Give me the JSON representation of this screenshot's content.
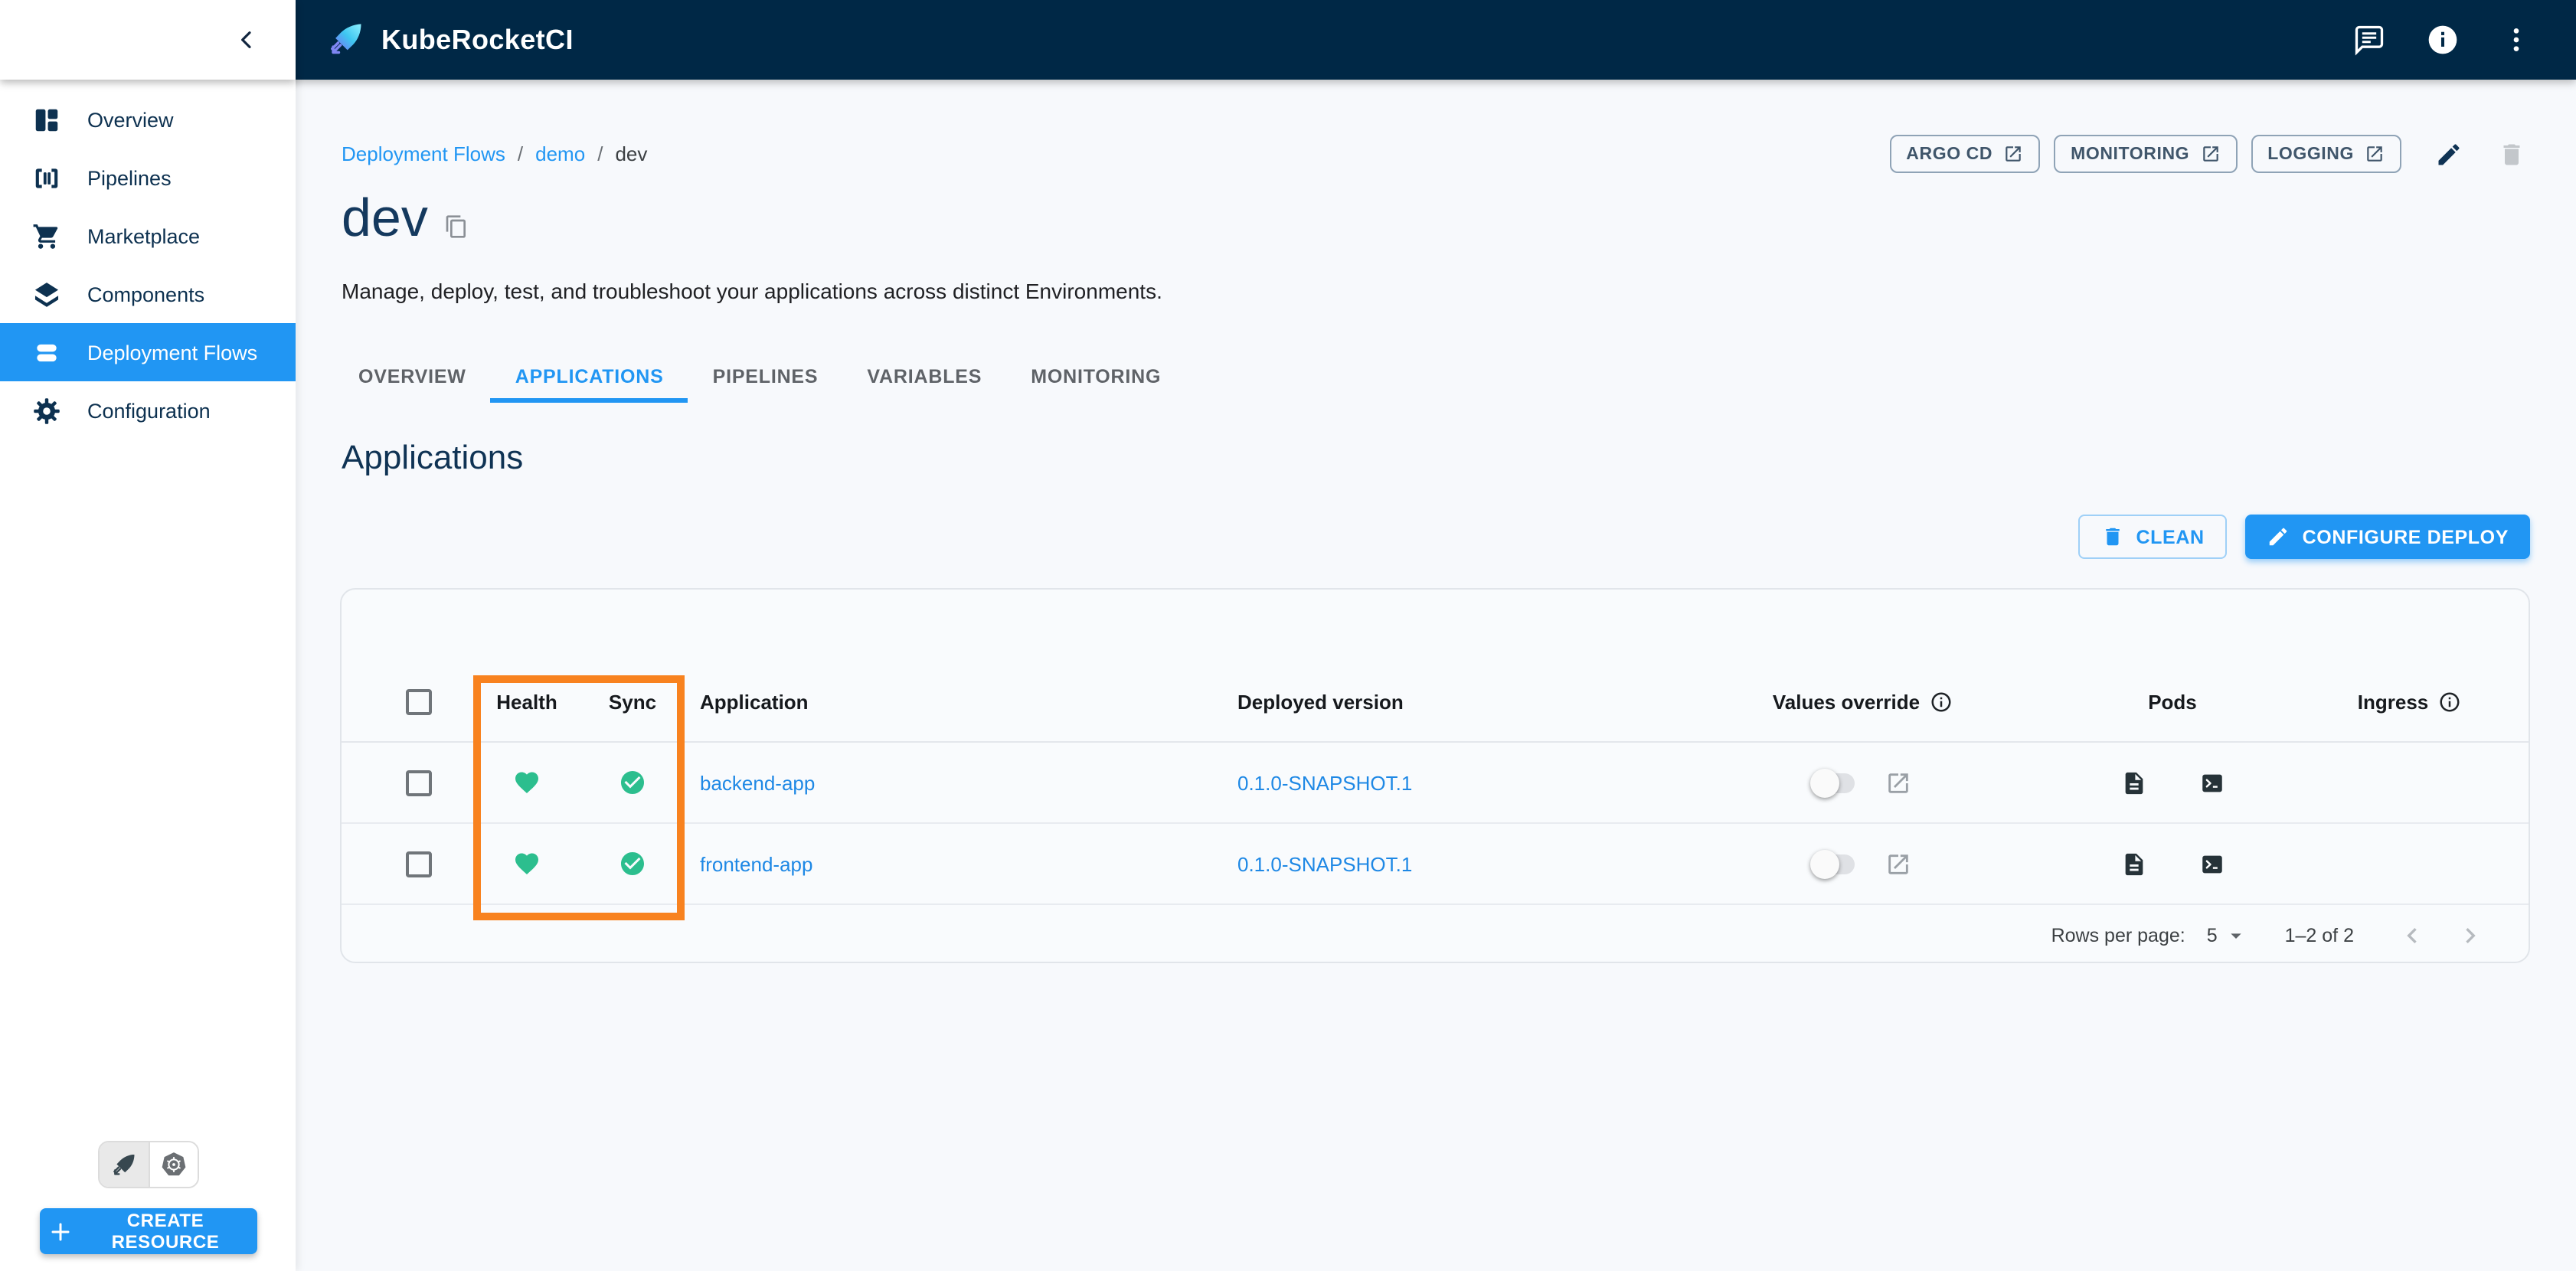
{
  "topbar": {
    "title": "KubeRocketCI",
    "icons": [
      "feedback-icon",
      "info-icon",
      "kebab-menu-icon"
    ]
  },
  "sidebar": {
    "collapse_icon": "chevron-left-icon",
    "items": [
      {
        "label": "Overview",
        "icon": "dashboard-icon",
        "selected": false
      },
      {
        "label": "Pipelines",
        "icon": "pipelines-icon",
        "selected": false
      },
      {
        "label": "Marketplace",
        "icon": "cart-icon",
        "selected": false
      },
      {
        "label": "Components",
        "icon": "layers-icon",
        "selected": false
      },
      {
        "label": "Deployment Flows",
        "icon": "stacked-bars-icon",
        "selected": true
      },
      {
        "label": "Configuration",
        "icon": "gear-icon",
        "selected": false
      }
    ],
    "view_toggle": [
      "kuberocketci-view-icon",
      "kubernetes-view-icon"
    ],
    "create_button": "CREATE RESOURCE"
  },
  "breadcrumb": {
    "separator": "/",
    "items": [
      {
        "label": "Deployment Flows",
        "link": true
      },
      {
        "label": "demo",
        "link": true
      },
      {
        "label": "dev",
        "link": false
      }
    ]
  },
  "page": {
    "title": "dev",
    "description": "Manage, deploy, test, and troubleshoot your applications across distinct Environments."
  },
  "header_links": [
    {
      "label": "ARGO CD",
      "icon": "external-link-icon"
    },
    {
      "label": "MONITORING",
      "icon": "external-link-icon"
    },
    {
      "label": "LOGGING",
      "icon": "external-link-icon"
    }
  ],
  "header_icon_buttons": [
    "edit-icon",
    "delete-icon"
  ],
  "tabs": [
    {
      "label": "OVERVIEW",
      "active": false
    },
    {
      "label": "APPLICATIONS",
      "active": true
    },
    {
      "label": "PIPELINES",
      "active": false
    },
    {
      "label": "VARIABLES",
      "active": false
    },
    {
      "label": "MONITORING",
      "active": false
    }
  ],
  "section": {
    "title": "Applications",
    "buttons": {
      "clean": "CLEAN",
      "configure_deploy": "CONFIGURE DEPLOY"
    }
  },
  "table": {
    "columns": {
      "health": "Health",
      "sync": "Sync",
      "application": "Application",
      "deployed_version": "Deployed version",
      "values_override": "Values override",
      "pods": "Pods",
      "ingress": "Ingress"
    },
    "row_icons": [
      "health-heart-icon",
      "sync-check-icon",
      "values-override-toggle",
      "external-link-icon",
      "pod-logs-icon",
      "pod-terminal-icon"
    ],
    "rows": [
      {
        "application": "backend-app",
        "deployed_version": "0.1.0-SNAPSHOT.1",
        "health": "healthy",
        "sync": "synced",
        "values_override": "off"
      },
      {
        "application": "frontend-app",
        "deployed_version": "0.1.0-SNAPSHOT.1",
        "health": "healthy",
        "sync": "synced",
        "values_override": "off"
      }
    ]
  },
  "pagination": {
    "rows_per_page_label": "Rows per page:",
    "rows_per_page": "5",
    "range": "1–2 of 2"
  },
  "annotation": {
    "highlight_color": "#f8821f",
    "highlighted_columns": [
      "Health",
      "Sync"
    ]
  },
  "colors": {
    "topbar_bg": "#002846",
    "accent_blue": "#2196f3",
    "link_blue": "#1e88e5",
    "success_green": "#2cbe8e",
    "highlight_orange": "#f8821f",
    "page_bg": "#f7f9fc"
  }
}
